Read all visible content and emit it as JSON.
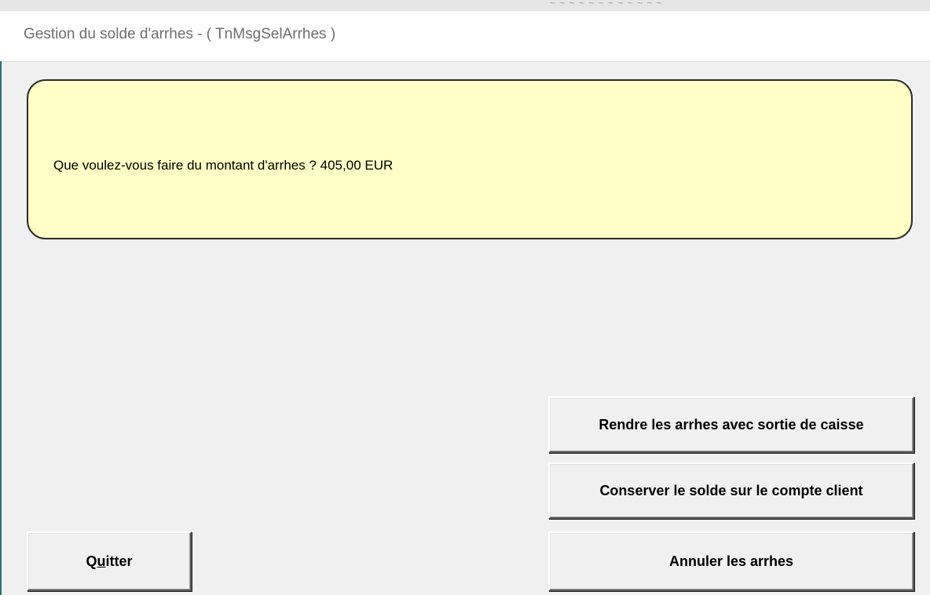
{
  "window": {
    "title": "Gestion du solde d'arrhes - ( TnMsgSelArrhes )",
    "background_text": "~ ~ ~ ~ ~ ~ ~ ~ ~ ~ ~ ~"
  },
  "message": {
    "text": "Que voulez-vous faire du montant d'arrhes ? 405,00 EUR",
    "box_color": "#ffffc6"
  },
  "buttons": {
    "rendre_label": "Rendre les arrhes avec sortie de caisse",
    "conserver_label": "Conserver le solde sur le compte client",
    "annuler_label": "Annuler les arrhes",
    "quitter_label_prefix": "Q",
    "quitter_label_mnemonic": "u",
    "quitter_label_suffix": "itter"
  },
  "colors": {
    "window_bg": "#f0f0f0",
    "title_text": "#6e6e6e"
  }
}
